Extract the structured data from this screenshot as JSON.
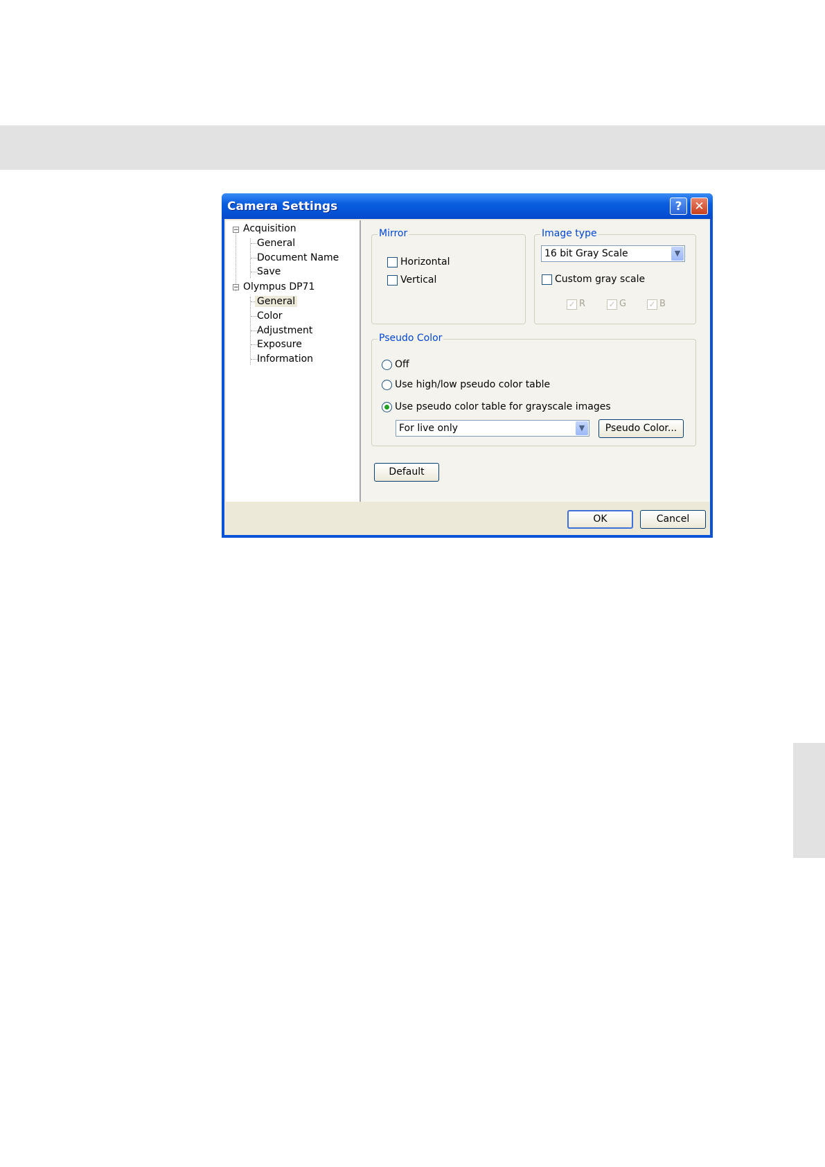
{
  "dialog": {
    "title": "Camera Settings",
    "help_glyph": "?",
    "close_glyph": "✕"
  },
  "tree": {
    "items": [
      {
        "label": "Acquisition",
        "expander": "−"
      },
      {
        "label": "General"
      },
      {
        "label": "Document Name"
      },
      {
        "label": "Save"
      },
      {
        "label": "Olympus DP71",
        "expander": "−"
      },
      {
        "label": "General",
        "selected": true
      },
      {
        "label": "Color"
      },
      {
        "label": "Adjustment"
      },
      {
        "label": "Exposure"
      },
      {
        "label": "Information"
      }
    ]
  },
  "mirror": {
    "title": "Mirror",
    "horizontal": {
      "label": "Horizontal",
      "checked": false
    },
    "vertical": {
      "label": "Vertical",
      "checked": false
    }
  },
  "image_type": {
    "title": "Image type",
    "selected": "16 bit Gray Scale",
    "custom_gray": {
      "label": "Custom gray scale",
      "checked": false
    },
    "r": {
      "label": "R",
      "checked": true,
      "disabled": true
    },
    "g": {
      "label": "G",
      "checked": true,
      "disabled": true
    },
    "b": {
      "label": "B",
      "checked": true,
      "disabled": true
    }
  },
  "pseudo_color": {
    "title": "Pseudo Color",
    "options": [
      {
        "label": "Off",
        "selected": false
      },
      {
        "label": "Use high/low pseudo color table",
        "selected": false
      },
      {
        "label": "Use pseudo color table for grayscale images",
        "selected": true
      }
    ],
    "mode_selected": "For live only",
    "button_label": "Pseudo Color..."
  },
  "buttons": {
    "default_label": "Default",
    "ok_label": "OK",
    "cancel_label": "Cancel"
  },
  "icons": {
    "check": "✓",
    "dropdown": "▼"
  },
  "colors": {
    "title_bar": "#0a5ee0",
    "group_title": "#0046d5",
    "radio_dot": "#21a121"
  }
}
